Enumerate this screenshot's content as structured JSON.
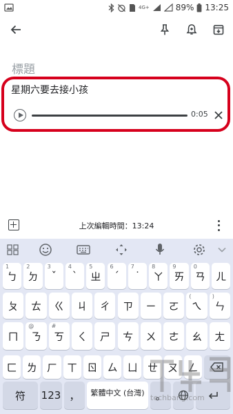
{
  "status_bar": {
    "battery": "89%",
    "time": "13:25",
    "network": "4G+"
  },
  "toolbar": {
    "icons": [
      "back-arrow-icon",
      "pin-icon",
      "reminder-bell-icon",
      "archive-icon"
    ]
  },
  "note": {
    "title_placeholder": "標題",
    "body": "星期六要去接小孩",
    "audio": {
      "duration": "0:05",
      "progress": 0.0
    }
  },
  "bottom_bar": {
    "last_edit": "上次編輯時間：13:24"
  },
  "keyboard": {
    "row1": [
      {
        "hint": "1",
        "key": "ㄅ"
      },
      {
        "hint": "2",
        "key": "ㄉ"
      },
      {
        "hint": "3",
        "key": "ˇ"
      },
      {
        "hint": "4",
        "key": "ˋ"
      },
      {
        "hint": "5",
        "key": "ㄓ"
      },
      {
        "hint": "6",
        "key": "ˊ"
      },
      {
        "hint": "7",
        "key": "˙"
      },
      {
        "hint": "8",
        "key": "ㄚ"
      },
      {
        "hint": "9",
        "key": "ㄞ"
      },
      {
        "hint": "0",
        "key": "ㄢ"
      },
      {
        "hint": "",
        "key": "ㄦ"
      }
    ],
    "row2": [
      {
        "hint": "",
        "key": "ㄆ"
      },
      {
        "hint": "",
        "key": "ㄊ"
      },
      {
        "hint": "",
        "key": "ㄍ"
      },
      {
        "hint": "",
        "key": "ㄐ"
      },
      {
        "hint": "",
        "key": "ㄔ"
      },
      {
        "hint": "",
        "key": "ㄗ"
      },
      {
        "hint": "",
        "key": "ㄧ"
      },
      {
        "hint": "",
        "key": "ㄛ"
      },
      {
        "hint": "(",
        "key": "ㄟ"
      },
      {
        "hint": ")",
        "key": "ㄣ"
      }
    ],
    "row3": [
      {
        "hint": "",
        "key": "ㄇ"
      },
      {
        "hint": "@",
        "key": "ㄋ"
      },
      {
        "hint": "#",
        "key": "ㄎ"
      },
      {
        "hint": "",
        "key": "ㄑ"
      },
      {
        "hint": "",
        "key": "ㄕ"
      },
      {
        "hint": "",
        "key": "ㄘ"
      },
      {
        "hint": "",
        "key": "ㄨ"
      },
      {
        "hint": "",
        "key": "ㄜ"
      },
      {
        "hint": "",
        "key": "ㄠ"
      },
      {
        "hint": "",
        "key": "ㄤ"
      }
    ],
    "row4": [
      {
        "hint": "",
        "key": "ㄈ"
      },
      {
        "hint": "",
        "key": "ㄌ"
      },
      {
        "hint": "",
        "key": "ㄏ"
      },
      {
        "hint": "",
        "key": "ㄒ"
      },
      {
        "hint": "",
        "key": "ㄖ"
      },
      {
        "hint": "",
        "key": "ㄙ"
      },
      {
        "hint": "",
        "key": "ㄩ"
      },
      {
        "hint": "",
        "key": "ㄝ"
      },
      {
        "hint": "",
        "key": "ㄡ"
      },
      {
        "hint": "",
        "key": "ㄥ"
      }
    ],
    "symbols_key": "符",
    "numbers_key": "123",
    "comma_key": "，",
    "space_label": "繁體中文 (台灣)",
    "period_key": "。",
    "tools": [
      "keyboard-grid-icon",
      "emoji-icon",
      "keyboard-icon",
      "move-cursor-icon",
      "microphone-icon",
      "settings-icon",
      "collapse-chevron-icon"
    ]
  },
  "watermark": {
    "text": "techbang.com"
  }
}
